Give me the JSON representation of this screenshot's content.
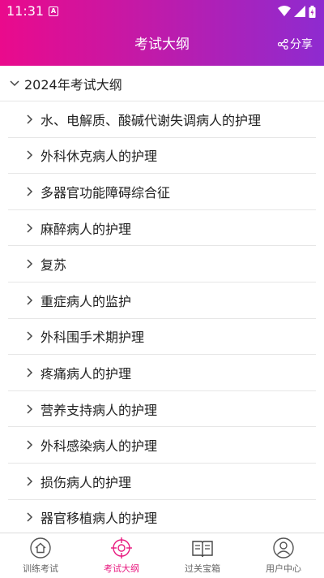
{
  "status": {
    "time": "11:31"
  },
  "header": {
    "title": "考试大纲",
    "share_label": "分享"
  },
  "section": {
    "label": "2024年考试大纲"
  },
  "items": [
    {
      "label": "水、电解质、酸碱代谢失调病人的护理"
    },
    {
      "label": "外科休克病人的护理"
    },
    {
      "label": "多器官功能障碍综合征"
    },
    {
      "label": "麻醉病人的护理"
    },
    {
      "label": "复苏"
    },
    {
      "label": "重症病人的监护"
    },
    {
      "label": "外科围手术期护理"
    },
    {
      "label": "疼痛病人的护理"
    },
    {
      "label": "营养支持病人的护理"
    },
    {
      "label": "外科感染病人的护理"
    },
    {
      "label": "损伤病人的护理"
    },
    {
      "label": "器官移植病人的护理"
    }
  ],
  "tabs": [
    {
      "label": "训练考试",
      "icon": "home-icon",
      "active": false
    },
    {
      "label": "考试大纲",
      "icon": "target-icon",
      "active": true
    },
    {
      "label": "过关宝箱",
      "icon": "book-icon",
      "active": false
    },
    {
      "label": "用户中心",
      "icon": "user-icon",
      "active": false
    }
  ],
  "colors": {
    "accent": "#e8197f",
    "header_start": "#ea0a8c",
    "header_end": "#8e2bd0"
  }
}
